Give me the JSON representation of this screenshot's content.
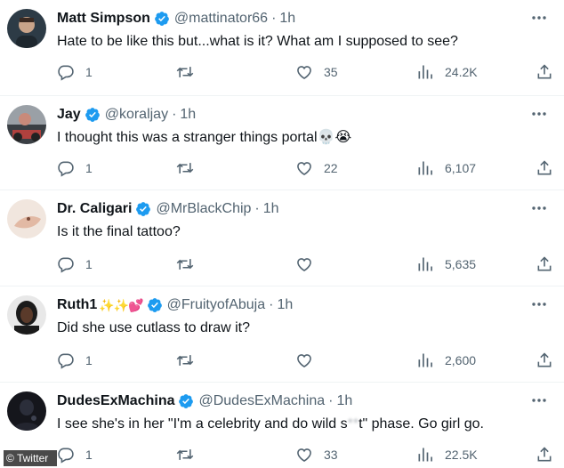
{
  "tweets": [
    {
      "name": "Matt Simpson",
      "name_emojis": "",
      "handle": "@mattinator66",
      "time": "1h",
      "text": "Hate to be like this but...what is it? What am I supposed to see?",
      "text_emojis": "",
      "replies": "1",
      "retweets": "",
      "likes": "35",
      "views": "24.2K"
    },
    {
      "name": "Jay",
      "name_emojis": "",
      "handle": "@koraljay",
      "time": "1h",
      "text": "I thought this was a stranger things portal",
      "text_emojis": "💀😭",
      "replies": "1",
      "retweets": "",
      "likes": "22",
      "views": "6,107"
    },
    {
      "name": "Dr. Caligari",
      "name_emojis": "",
      "handle": "@MrBlackChip",
      "time": "1h",
      "text": "Is it the final tattoo?",
      "text_emojis": "",
      "replies": "1",
      "retweets": "",
      "likes": "",
      "views": "5,635"
    },
    {
      "name": "Ruth1",
      "name_emojis": "✨✨💕",
      "handle": "@FruityofAbuja",
      "time": "1h",
      "text": "Did she use cutlass to draw it?",
      "text_emojis": "",
      "replies": "1",
      "retweets": "",
      "likes": "",
      "views": "2,600"
    },
    {
      "name": "DudesExMachina",
      "name_emojis": "",
      "handle": "@DudesExMachina",
      "time": "1h",
      "text_pre": "I see she's in her \"I'm a celebrity and do wild s",
      "text_censored": "**",
      "text_post": "t\" phase. Go girl go.",
      "replies": "1",
      "retweets": "",
      "likes": "33",
      "views": "22.5K"
    }
  ],
  "separator": "·",
  "watermark": "© Twitter",
  "colors": {
    "verified": "#1d9bf0",
    "muted": "#536471",
    "text": "#0f1419",
    "divider": "#eff3f4"
  },
  "icons": {
    "reply": "reply-icon",
    "retweet": "retweet-icon",
    "like": "heart-icon",
    "views": "views-icon",
    "share": "share-icon",
    "more": "more-icon",
    "verified": "verified-badge-icon"
  }
}
